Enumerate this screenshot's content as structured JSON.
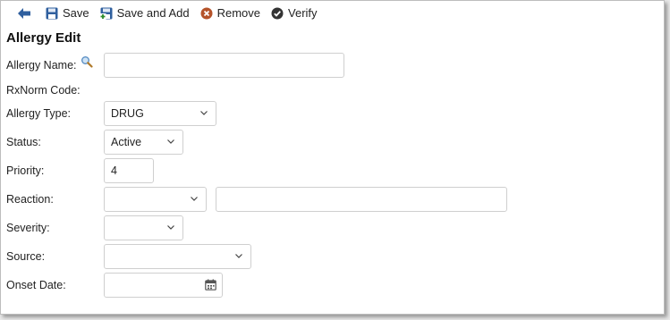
{
  "toolbar": {
    "save_label": "Save",
    "save_add_label": "Save and Add",
    "remove_label": "Remove",
    "verify_label": "Verify"
  },
  "page_title": "Allergy Edit",
  "form": {
    "allergy_name": {
      "label": "Allergy Name:",
      "value": ""
    },
    "rxnorm_code": {
      "label": "RxNorm Code:"
    },
    "allergy_type": {
      "label": "Allergy Type:",
      "value": "DRUG"
    },
    "status": {
      "label": "Status:",
      "value": "Active"
    },
    "priority": {
      "label": "Priority:",
      "value": "4"
    },
    "reaction": {
      "label": "Reaction:",
      "value": "",
      "text_value": ""
    },
    "severity": {
      "label": "Severity:",
      "value": ""
    },
    "source": {
      "label": "Source:",
      "value": ""
    },
    "onset_date": {
      "label": "Onset Date:",
      "value": ""
    }
  },
  "icons": {
    "back": "back-arrow-icon",
    "save": "floppy-disk-icon",
    "save_add": "floppy-disk-add-icon",
    "remove": "remove-circle-icon",
    "verify": "check-circle-icon",
    "search": "magnifier-icon",
    "calendar": "calendar-icon"
  },
  "colors": {
    "accent_blue": "#2f5f9e",
    "remove_orange": "#b5532a",
    "verify_dark": "#333333"
  }
}
